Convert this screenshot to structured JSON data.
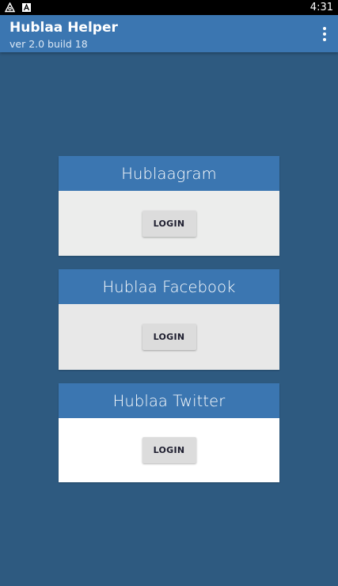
{
  "status_bar": {
    "time": "4:31",
    "icons": [
      "hotspot-icon",
      "android-a-icon"
    ]
  },
  "app_bar": {
    "title": "Hublaa Helper",
    "subtitle": "ver 2.0 build 18",
    "menu_icon": "overflow-menu-icon"
  },
  "cards": [
    {
      "title": "Hublaagram",
      "button_label": "LOGIN"
    },
    {
      "title": "Hublaa Facebook",
      "button_label": "LOGIN"
    },
    {
      "title": "Hublaa Twitter",
      "button_label": "LOGIN"
    }
  ],
  "colors": {
    "background": "#2e5a80",
    "app_bar": "#3b76b1",
    "card_header": "#3b76b1",
    "button": "#dcdcdc"
  }
}
